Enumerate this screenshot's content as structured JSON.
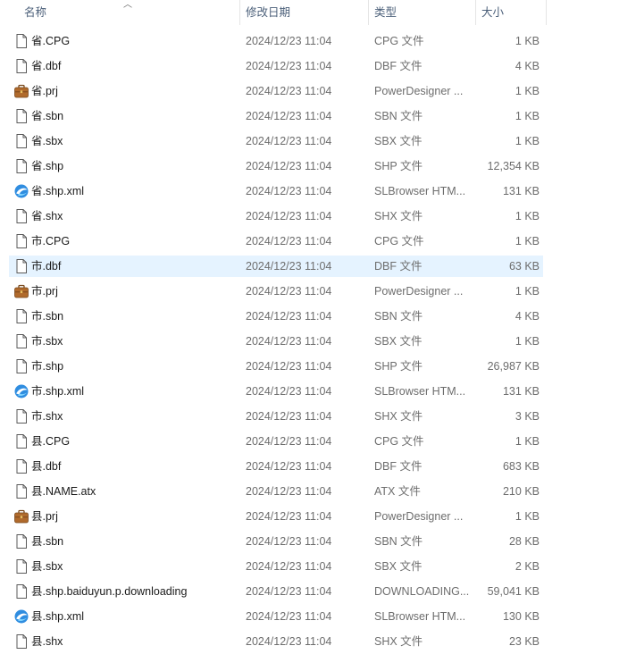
{
  "columns": {
    "name": "名称",
    "date": "修改日期",
    "type": "类型",
    "size": "大小"
  },
  "files": [
    {
      "name": "省.CPG",
      "date": "2024/12/23 11:04",
      "type": "CPG 文件",
      "size": "1 KB",
      "icon": "file-icon"
    },
    {
      "name": "省.dbf",
      "date": "2024/12/23 11:04",
      "type": "DBF 文件",
      "size": "4 KB",
      "icon": "file-icon"
    },
    {
      "name": "省.prj",
      "date": "2024/12/23 11:04",
      "type": "PowerDesigner ...",
      "size": "1 KB",
      "icon": "briefcase-icon"
    },
    {
      "name": "省.sbn",
      "date": "2024/12/23 11:04",
      "type": "SBN 文件",
      "size": "1 KB",
      "icon": "file-icon"
    },
    {
      "name": "省.sbx",
      "date": "2024/12/23 11:04",
      "type": "SBX 文件",
      "size": "1 KB",
      "icon": "file-icon"
    },
    {
      "name": "省.shp",
      "date": "2024/12/23 11:04",
      "type": "SHP 文件",
      "size": "12,354 KB",
      "icon": "file-icon"
    },
    {
      "name": "省.shp.xml",
      "date": "2024/12/23 11:04",
      "type": "SLBrowser HTM...",
      "size": "131 KB",
      "icon": "browser-icon"
    },
    {
      "name": "省.shx",
      "date": "2024/12/23 11:04",
      "type": "SHX 文件",
      "size": "1 KB",
      "icon": "file-icon"
    },
    {
      "name": "市.CPG",
      "date": "2024/12/23 11:04",
      "type": "CPG 文件",
      "size": "1 KB",
      "icon": "file-icon"
    },
    {
      "name": "市.dbf",
      "date": "2024/12/23 11:04",
      "type": "DBF 文件",
      "size": "63 KB",
      "icon": "file-icon",
      "selected": true
    },
    {
      "name": "市.prj",
      "date": "2024/12/23 11:04",
      "type": "PowerDesigner ...",
      "size": "1 KB",
      "icon": "briefcase-icon"
    },
    {
      "name": "市.sbn",
      "date": "2024/12/23 11:04",
      "type": "SBN 文件",
      "size": "4 KB",
      "icon": "file-icon"
    },
    {
      "name": "市.sbx",
      "date": "2024/12/23 11:04",
      "type": "SBX 文件",
      "size": "1 KB",
      "icon": "file-icon"
    },
    {
      "name": "市.shp",
      "date": "2024/12/23 11:04",
      "type": "SHP 文件",
      "size": "26,987 KB",
      "icon": "file-icon"
    },
    {
      "name": "市.shp.xml",
      "date": "2024/12/23 11:04",
      "type": "SLBrowser HTM...",
      "size": "131 KB",
      "icon": "browser-icon"
    },
    {
      "name": "市.shx",
      "date": "2024/12/23 11:04",
      "type": "SHX 文件",
      "size": "3 KB",
      "icon": "file-icon"
    },
    {
      "name": "县.CPG",
      "date": "2024/12/23 11:04",
      "type": "CPG 文件",
      "size": "1 KB",
      "icon": "file-icon"
    },
    {
      "name": "县.dbf",
      "date": "2024/12/23 11:04",
      "type": "DBF 文件",
      "size": "683 KB",
      "icon": "file-icon"
    },
    {
      "name": "县.NAME.atx",
      "date": "2024/12/23 11:04",
      "type": "ATX 文件",
      "size": "210 KB",
      "icon": "file-icon"
    },
    {
      "name": "县.prj",
      "date": "2024/12/23 11:04",
      "type": "PowerDesigner ...",
      "size": "1 KB",
      "icon": "briefcase-icon"
    },
    {
      "name": "县.sbn",
      "date": "2024/12/23 11:04",
      "type": "SBN 文件",
      "size": "28 KB",
      "icon": "file-icon"
    },
    {
      "name": "县.sbx",
      "date": "2024/12/23 11:04",
      "type": "SBX 文件",
      "size": "2 KB",
      "icon": "file-icon"
    },
    {
      "name": "县.shp.baiduyun.p.downloading",
      "date": "2024/12/23 11:04",
      "type": "DOWNLOADING...",
      "size": "59,041 KB",
      "icon": "file-icon"
    },
    {
      "name": "县.shp.xml",
      "date": "2024/12/23 11:04",
      "type": "SLBrowser HTM...",
      "size": "130 KB",
      "icon": "browser-icon"
    },
    {
      "name": "县.shx",
      "date": "2024/12/23 11:04",
      "type": "SHX 文件",
      "size": "23 KB",
      "icon": "file-icon"
    }
  ]
}
